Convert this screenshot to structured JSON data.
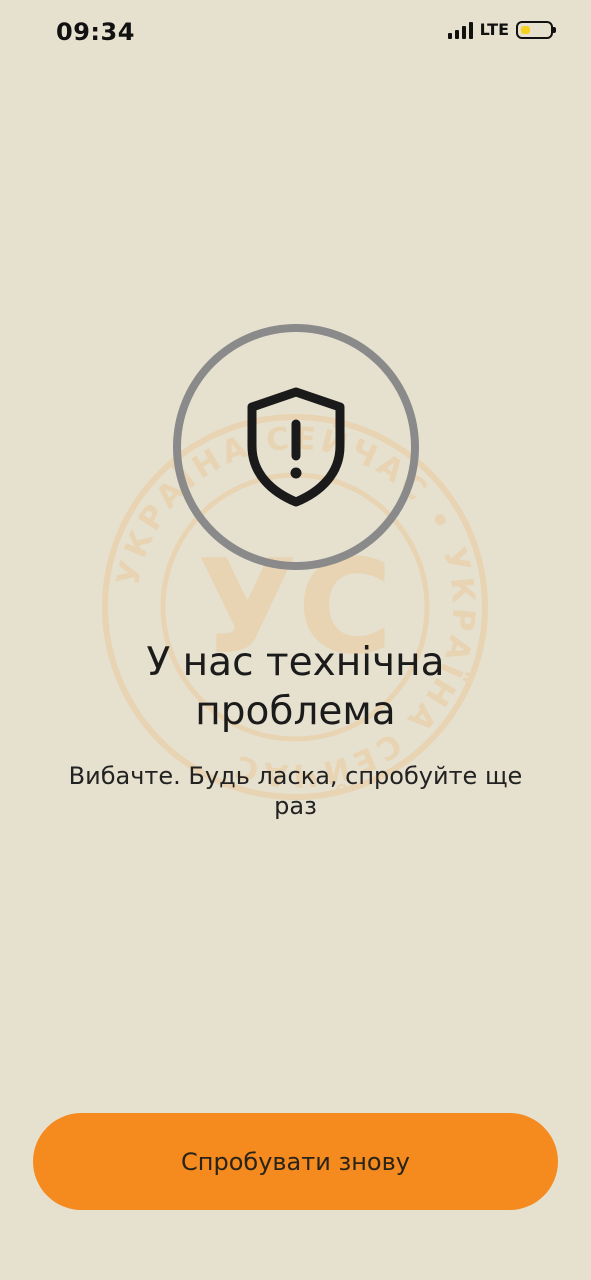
{
  "status_bar": {
    "time": "09:34",
    "network": "LTE",
    "signal_icon": "signal-bars-icon",
    "battery_icon": "battery-icon",
    "battery_level_fraction": 0.35,
    "battery_fill_color": "#f6d11d"
  },
  "watermark": {
    "monogram": "УС",
    "brand_text": "УКРАЇНА СЕЙЧАС"
  },
  "error": {
    "icon": "shield-warning-icon",
    "title": "У нас технічна проблема",
    "subtitle": "Вибачте. Будь ласка, спробуйте ще раз"
  },
  "actions": {
    "retry_label": "Спробувати знову"
  },
  "colors": {
    "background": "#e6e0cf",
    "accent": "#f58a1f",
    "icon_ring": "#8a8a8a",
    "watermark": "#ecc58f"
  }
}
